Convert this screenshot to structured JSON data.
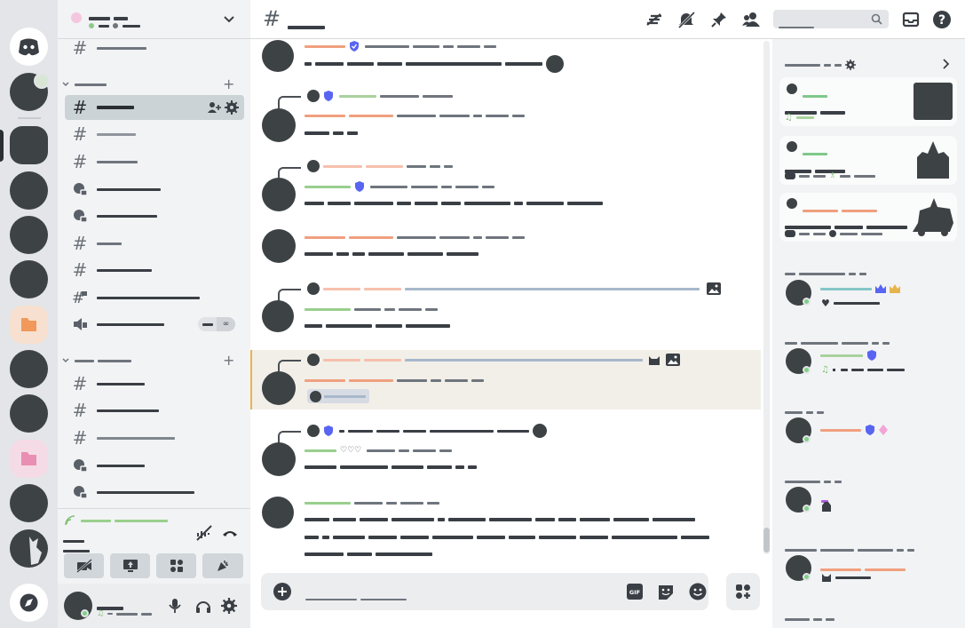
{
  "colors": {
    "accent": "#5865f2",
    "online": "#7fd185",
    "highlight": "#e7b44c",
    "rail": "#e3e5e8"
  },
  "rail": {
    "home_icon": "discord-logo-icon",
    "explore_icon": "compass-icon"
  },
  "server_header": {
    "name": "",
    "dropdown_icon": "chevron-down-icon"
  },
  "topbar": {
    "channel_icon": "hash-icon",
    "channel_name": "",
    "search_placeholder": "",
    "icons": [
      "threads-icon",
      "notification-mute-icon",
      "pin-icon",
      "members-icon",
      "inbox-icon",
      "help-icon"
    ]
  },
  "composer": {
    "placeholder": "",
    "icons": [
      "add-attachment-icon",
      "gif-icon",
      "sticker-icon",
      "emoji-icon",
      "apps-icon"
    ]
  },
  "voice": {
    "status": "",
    "channel": "",
    "sub": ""
  },
  "user": {
    "name": "",
    "status": ""
  },
  "members_header": {
    "title": ""
  }
}
